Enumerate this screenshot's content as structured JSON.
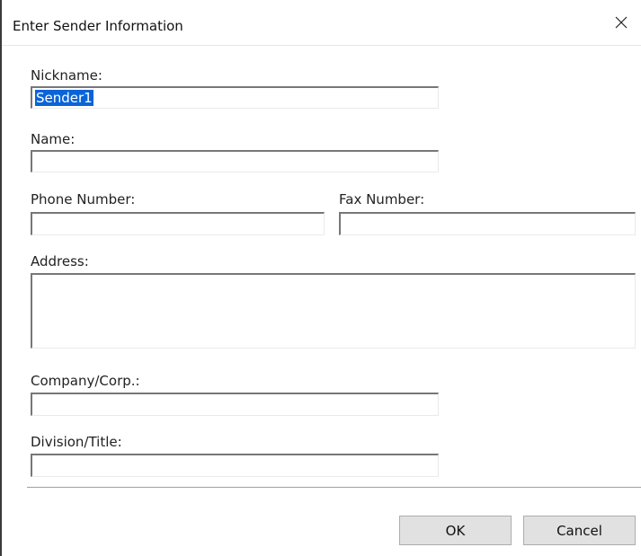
{
  "window": {
    "title": "Enter Sender Information",
    "close_icon": "close-icon"
  },
  "form": {
    "nickname": {
      "label": "Nickname:",
      "value": "Sender1"
    },
    "name": {
      "label": "Name:",
      "value": ""
    },
    "phone": {
      "label": "Phone Number:",
      "value": ""
    },
    "fax": {
      "label": "Fax Number:",
      "value": ""
    },
    "address": {
      "label": "Address:",
      "value": ""
    },
    "company": {
      "label": "Company/Corp.:",
      "value": ""
    },
    "division": {
      "label": "Division/Title:",
      "value": ""
    }
  },
  "buttons": {
    "ok": "OK",
    "cancel": "Cancel"
  },
  "colors": {
    "selection": "#0a64d8",
    "button_face": "#e1e1e1"
  }
}
